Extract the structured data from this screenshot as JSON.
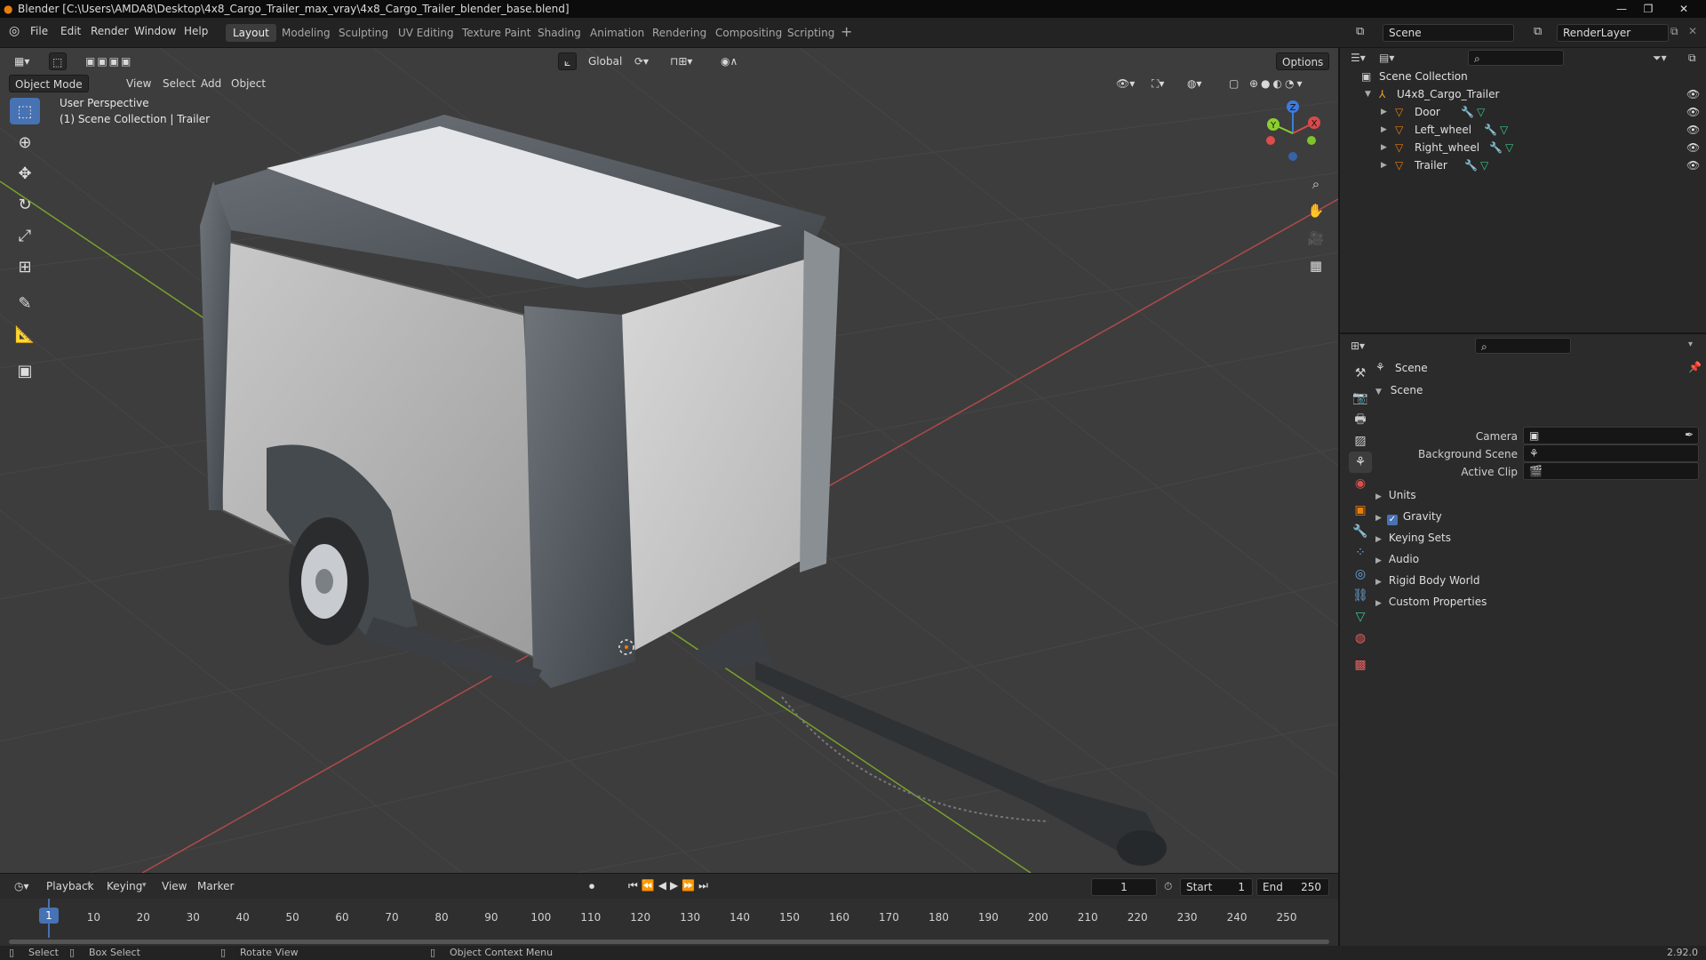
{
  "window": {
    "title": "Blender [C:\\Users\\AMDA8\\Desktop\\4x8_Cargo_Trailer_max_vray\\4x8_Cargo_Trailer_blender_base.blend]"
  },
  "menu": [
    "File",
    "Edit",
    "Render",
    "Window",
    "Help"
  ],
  "workspaces": [
    "Layout",
    "Modeling",
    "Sculpting",
    "UV Editing",
    "Texture Paint",
    "Shading",
    "Animation",
    "Rendering",
    "Compositing",
    "Scripting"
  ],
  "scene_field": "Scene",
  "renderlayer_field": "RenderLayer",
  "header": {
    "transform_orientation": "Global",
    "options": "Options"
  },
  "viewport": {
    "mode": "Object Mode",
    "menus": [
      "View",
      "Select",
      "Add",
      "Object"
    ],
    "info_line1": "User Perspective",
    "info_line2": "(1) Scene Collection | Trailer"
  },
  "gizmo": {
    "x": "X",
    "y": "Y",
    "z": "Z"
  },
  "outliner": {
    "root": "Scene Collection",
    "collection": "U4x8_Cargo_Trailer",
    "objects": [
      "Door",
      "Left_wheel",
      "Right_wheel",
      "Trailer"
    ]
  },
  "properties": {
    "context": "Scene",
    "panel": "Scene",
    "camera_label": "Camera",
    "bgscene_label": "Background Scene",
    "activeclip_label": "Active Clip",
    "sections": [
      "Units",
      "Gravity",
      "Keying Sets",
      "Audio",
      "Rigid Body World",
      "Custom Properties"
    ],
    "gravity_checked": true
  },
  "timeline": {
    "menus": [
      "Playback",
      "Keying",
      "View",
      "Marker"
    ],
    "current_frame": "1",
    "start_label": "Start",
    "start": "1",
    "end_label": "End",
    "end": "250",
    "ticks": [
      "1",
      "10",
      "20",
      "30",
      "40",
      "50",
      "60",
      "70",
      "80",
      "90",
      "100",
      "110",
      "120",
      "130",
      "140",
      "150",
      "160",
      "170",
      "180",
      "190",
      "200",
      "210",
      "220",
      "230",
      "240",
      "250"
    ]
  },
  "status": {
    "select": "Select",
    "box_select": "Box Select",
    "rotate": "Rotate View",
    "context_menu": "Object Context Menu",
    "version": "2.92.0"
  },
  "colors": {
    "accent": "#4772b3",
    "x_axis": "#d94a4a",
    "y_axis": "#8ccf2e",
    "z_axis": "#3d7be0",
    "viewport_bg": "#3d3d3d"
  }
}
